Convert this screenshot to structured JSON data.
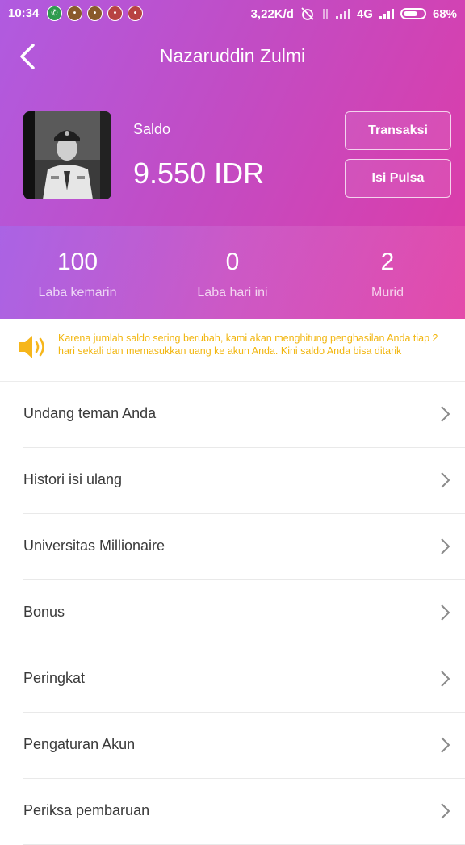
{
  "status_bar": {
    "time": "10:34",
    "network_speed": "3,22K/d",
    "network_type": "4G",
    "battery": "68%"
  },
  "header": {
    "title": "Nazaruddin Zulmi",
    "back_icon": "chevron-left-icon"
  },
  "balance": {
    "label": "Saldo",
    "value": "9.550 IDR",
    "transaction_button": "Transaksi",
    "topup_button": "Isi Pulsa"
  },
  "stats": [
    {
      "value": "100",
      "label": "Laba kemarin"
    },
    {
      "value": "0",
      "label": "Laba hari ini"
    },
    {
      "value": "2",
      "label": "Murid"
    }
  ],
  "notice": {
    "icon": "speaker-icon",
    "text": "Karena jumlah saldo sering berubah, kami akan menghitung penghasilan Anda tiap 2 hari sekali dan memasukkan uang ke akun Anda. Kini saldo Anda bisa ditarik",
    "color": "#f2b60f"
  },
  "menu": [
    {
      "label": "Undang teman Anda"
    },
    {
      "label": "Histori isi ulang"
    },
    {
      "label": "Universitas Millionaire"
    },
    {
      "label": "Bonus"
    },
    {
      "label": "Peringkat"
    },
    {
      "label": "Pengaturan Akun"
    },
    {
      "label": "Periksa pembaruan"
    }
  ],
  "colors": {
    "header_gradient_start": "#b05be0",
    "header_gradient_end": "#de3ba6"
  }
}
